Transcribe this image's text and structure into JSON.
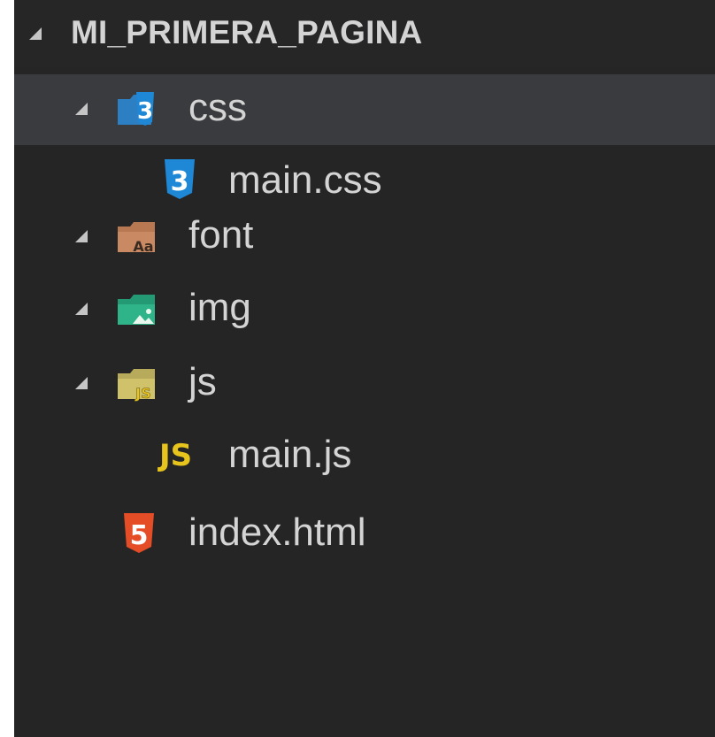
{
  "explorer": {
    "root": {
      "label": "MI_PRIMERA_PAGINA",
      "expand_icon": "triangle-down-icon"
    },
    "items": [
      {
        "label": "css",
        "type": "folder",
        "icon": "css-folder-icon",
        "expanded": true,
        "selected": true
      },
      {
        "label": "main.css",
        "type": "file",
        "icon": "css3-icon"
      },
      {
        "label": "font",
        "type": "folder",
        "icon": "font-folder-icon",
        "expanded": true
      },
      {
        "label": "img",
        "type": "folder",
        "icon": "image-folder-icon",
        "expanded": true
      },
      {
        "label": "js",
        "type": "folder",
        "icon": "js-folder-icon",
        "expanded": true
      },
      {
        "label": "main.js",
        "type": "file",
        "icon": "javascript-icon",
        "badge": "JS"
      },
      {
        "label": "index.html",
        "type": "file",
        "icon": "html5-icon"
      }
    ]
  },
  "colors": {
    "background": "#252526",
    "selected_row": "#3a3b3e",
    "text": "#d4d4d4",
    "css_blue": "#1e88d6",
    "html_orange": "#e44d26",
    "js_yellow": "#e8c51c",
    "font_folder": "#c98a63",
    "img_folder": "#2fb388",
    "js_folder": "#cfc26a"
  }
}
